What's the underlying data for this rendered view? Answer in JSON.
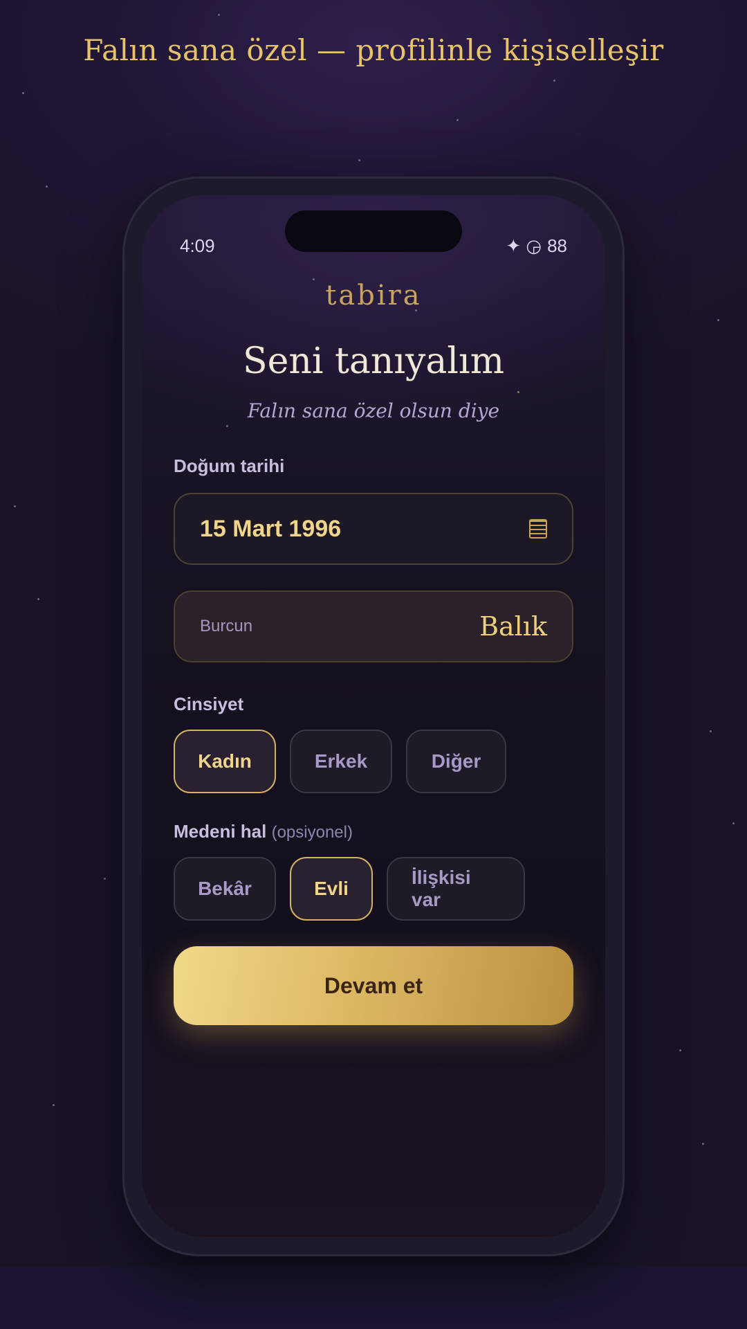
{
  "headline": "Falın sana özel — profilinle kişiselleşir",
  "status": {
    "time": "4:09",
    "icons": "✦ ◶",
    "battery": "88"
  },
  "app": {
    "logo": "tabira",
    "title": "Seni tanıyalım",
    "subtitle": "Falın sana özel olsun diye"
  },
  "birth": {
    "label": "Doğum tarihi",
    "value": "15 Mart 1996",
    "icon": "calendar-icon"
  },
  "sign": {
    "label": "Burcun",
    "value": "Balık"
  },
  "gender": {
    "label": "Cinsiyet",
    "options": [
      "Kadın",
      "Erkek",
      "Diğer"
    ],
    "selected": "Kadın"
  },
  "marital": {
    "label": "Medeni hal",
    "optional": "(opsiyonel)",
    "options": [
      "Bekâr",
      "Evli",
      "İlişkisi var"
    ],
    "selected": "Evli"
  },
  "cta": {
    "label": "Devam et"
  },
  "colors": {
    "accent": "#e7c46a",
    "background": "#1a1328",
    "cta_start": "#f0d889",
    "cta_end": "#b99040"
  }
}
